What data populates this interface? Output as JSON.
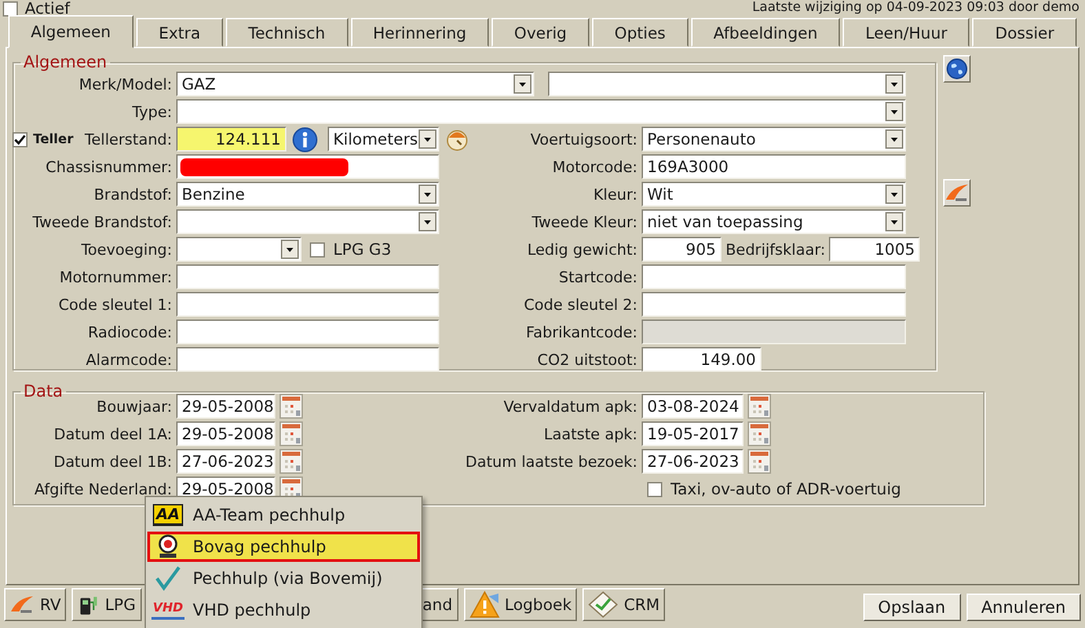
{
  "header": {
    "active": {
      "label": "Actief",
      "checked": false
    },
    "last_modified": "Laatste wijziging op 04-09-2023 09:03 door demo"
  },
  "tabs": [
    {
      "label": "Algemeen",
      "selected": true
    },
    {
      "label": "Extra",
      "selected": false
    },
    {
      "label": "Technisch",
      "selected": false
    },
    {
      "label": "Herinnering",
      "selected": false
    },
    {
      "label": "Overig",
      "selected": false
    },
    {
      "label": "Opties",
      "selected": false
    },
    {
      "label": "Afbeeldingen",
      "selected": false
    },
    {
      "label": "Leen/Huur",
      "selected": false
    },
    {
      "label": "Dossier",
      "selected": false
    }
  ],
  "general": {
    "title": "Algemeen",
    "left": [
      {
        "kind": "combo_pair",
        "label": "Merk/Model:",
        "value": "GAZ"
      },
      {
        "kind": "combo_wide",
        "label": "Type:"
      },
      {
        "kind": "counter",
        "label": "Tellerstand:",
        "value": "124.111",
        "unit": "Kilometers",
        "check": {
          "label": "Teller",
          "checked": true
        }
      },
      {
        "kind": "redacted",
        "label": "Chassisnummer:"
      },
      {
        "kind": "combo",
        "label": "Brandstof:",
        "value": "Benzine"
      },
      {
        "kind": "combo",
        "label": "Tweede Brandstof:"
      },
      {
        "kind": "combo_check",
        "label": "Toevoeging:",
        "check": {
          "label": "LPG G3",
          "checked": false
        }
      },
      {
        "kind": "text",
        "label": "Motornummer:"
      },
      {
        "kind": "text",
        "label": "Code sleutel 1:"
      },
      {
        "kind": "text",
        "label": "Radiocode:"
      },
      {
        "kind": "text",
        "label": "Alarmcode:"
      }
    ],
    "right": [
      {
        "kind": "combo",
        "label": "Voertuigsoort:",
        "value": "Personenauto",
        "disabled": false
      },
      {
        "kind": "text",
        "label": "Motorcode:",
        "value": "169A3000",
        "disabled": false
      },
      {
        "kind": "combo",
        "label": "Kleur:",
        "value": "Wit",
        "disabled": false
      },
      {
        "kind": "combo",
        "label": "Tweede Kleur:",
        "value": "niet van toepassing",
        "disabled": false
      },
      {
        "kind": "weights",
        "label": "Ledig gewicht:",
        "value": "905",
        "label_2": "Bedrijfsklaar:",
        "value_2": "1005",
        "disabled": false
      },
      {
        "kind": "text",
        "label": "Startcode:",
        "disabled": false
      },
      {
        "kind": "text",
        "label": "Code sleutel 2:",
        "disabled": false
      },
      {
        "kind": "text",
        "label": "Fabrikantcode:",
        "disabled": true
      },
      {
        "kind": "number",
        "label": "CO2 uitstoot:",
        "value": "149.00",
        "disabled": false
      }
    ]
  },
  "data": {
    "title": "Data",
    "left": [
      {
        "label": "Bouwjaar:",
        "value": "29-05-2008"
      },
      {
        "label": "Datum deel 1A:",
        "value": "29-05-2008"
      },
      {
        "label": "Datum deel 1B:",
        "value": "27-06-2023"
      },
      {
        "label": "Afgifte Nederland:",
        "value": "29-05-2008"
      }
    ],
    "right": [
      {
        "label": "Vervaldatum apk:",
        "value": "03-08-2024"
      },
      {
        "label": "Laatste apk:",
        "value": "19-05-2017"
      },
      {
        "label": "Datum laatste bezoek:",
        "value": "27-06-2023"
      }
    ],
    "taxi": {
      "label": "Taxi, ov-auto of ADR-voertuig",
      "checked": false
    }
  },
  "toolbar": [
    {
      "kind": "rdw",
      "label": "RV"
    },
    {
      "kind": "lpg",
      "label": "LPG"
    },
    {
      "kind": "covered",
      "label": "and"
    },
    {
      "kind": "logbook",
      "label": "Logboek"
    },
    {
      "kind": "crm",
      "label": "CRM"
    }
  ],
  "actions": [
    "Opslaan",
    "Annuleren"
  ],
  "menu": {
    "items": [
      {
        "kind": "aa",
        "label": "AA-Team pechhulp",
        "badge": "AA",
        "selected": false
      },
      {
        "kind": "bovag",
        "label": "Bovag pechhulp",
        "selected": true
      },
      {
        "kind": "check",
        "label": "Pechhulp (via Bovemij)",
        "selected": false
      },
      {
        "kind": "vhd",
        "label": "VHD pechhulp",
        "badge": "VHD",
        "selected": false
      }
    ]
  }
}
